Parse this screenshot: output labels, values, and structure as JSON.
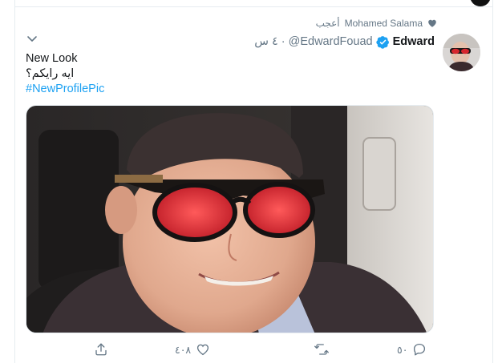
{
  "social_context": {
    "liker_name": "Mohamed Salama",
    "liked_label": "أعجب"
  },
  "author": {
    "name": "Edward",
    "handle": "@EdwardFouad",
    "time": "٤ س",
    "verified": true
  },
  "tweet": {
    "lines": [
      "New Look",
      "ايه رايكم؟"
    ],
    "hashtag": "#NewProfilePic"
  },
  "actions": {
    "reply_count": "٥٠",
    "retweet_count": "",
    "like_count": "٤٠٨"
  },
  "colors": {
    "link": "#1da1f2",
    "muted": "#657786",
    "verified": "#1da1f2"
  },
  "icons": [
    "heart-icon",
    "verified-badge-icon",
    "chevron-down-icon",
    "reply-icon",
    "retweet-icon",
    "like-icon",
    "share-icon"
  ]
}
